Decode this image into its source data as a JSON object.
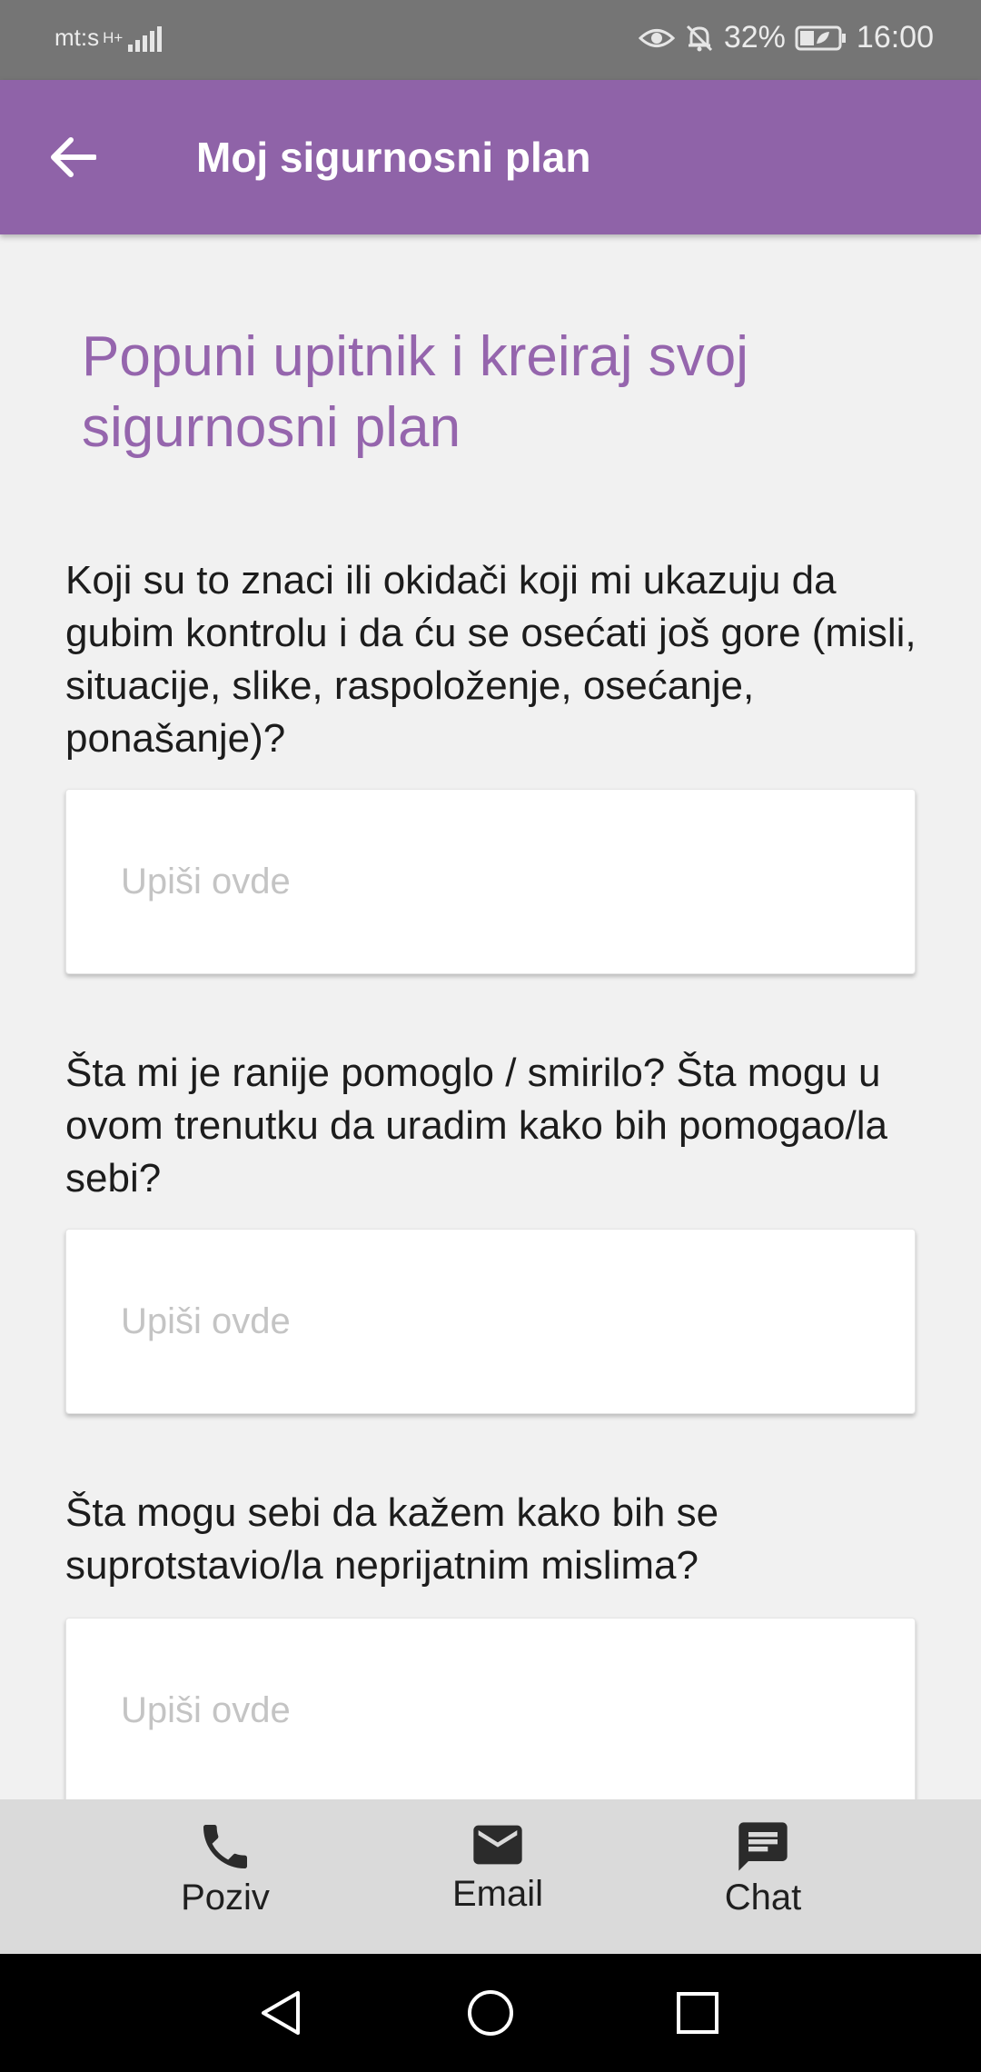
{
  "status_bar": {
    "carrier": "mt:s",
    "network": "H+",
    "battery": "32%",
    "time": "16:00"
  },
  "app_bar": {
    "title": "Moj sigurnosni plan"
  },
  "form": {
    "heading": "Popuni upitnik i kreiraj svoj sigurnosni plan",
    "questions": [
      {
        "text": "Koji su to znaci ili okidači koji mi ukazuju da gubim kontrolu i da ću se osećati još gore (misli, situacije, slike, raspoloženje, osećanje, ponašanje)?",
        "placeholder": "Upiši ovde",
        "value": ""
      },
      {
        "text": "Šta mi je ranije pomoglo / smirilo? Šta mogu u ovom trenutku da uradim kako bih pomogao/la sebi?",
        "placeholder": "Upiši ovde",
        "value": ""
      },
      {
        "text": "Šta mogu sebi da kažem kako bih se suprotstavio/la neprijatnim mislima?",
        "placeholder": "Upiši ovde",
        "value": ""
      }
    ]
  },
  "bottom_bar": {
    "items": [
      {
        "label": "Poziv",
        "icon": "phone-icon"
      },
      {
        "label": "Email",
        "icon": "email-icon"
      },
      {
        "label": "Chat",
        "icon": "chat-icon"
      }
    ]
  },
  "colors": {
    "accent": "#8f63a8",
    "heading": "#9565ad",
    "status_bar": "#757575",
    "bottom_bar": "#dadada",
    "background": "#f1f1f1"
  }
}
